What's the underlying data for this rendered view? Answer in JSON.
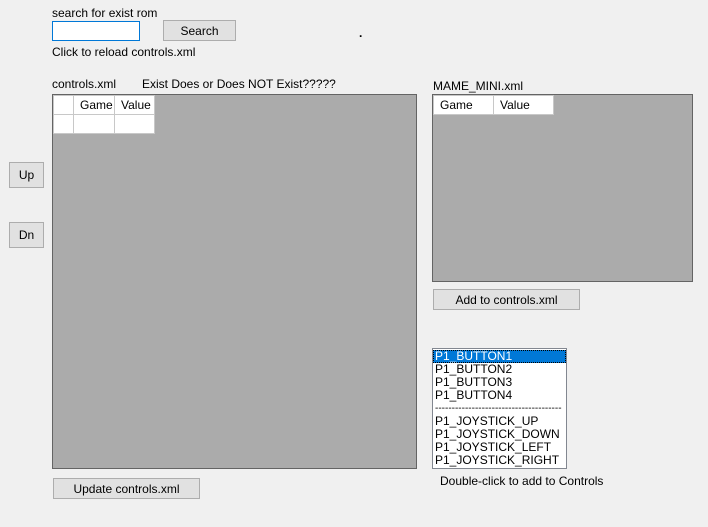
{
  "search": {
    "label": "search for exist rom",
    "value": "",
    "button_label": "Search"
  },
  "reload_label": "Click to reload controls.xml",
  "dot": ".",
  "controls": {
    "label": "controls.xml",
    "exist_label": "Exist Does or Does NOT Exist?????",
    "columns": [
      "Game",
      "Value"
    ],
    "update_button_label": "Update controls.xml"
  },
  "mame": {
    "label": "MAME_MINI.xml",
    "columns": [
      "Game",
      "Value"
    ],
    "add_button_label": "Add to controls.xml"
  },
  "nav": {
    "up_label": "Up",
    "dn_label": "Dn"
  },
  "listbox": {
    "items": [
      "P1_BUTTON1",
      "P1_BUTTON2",
      "P1_BUTTON3",
      "P1_BUTTON4",
      "--------------------------------------",
      "P1_JOYSTICK_UP",
      "P1_JOYSTICK_DOWN",
      "P1_JOYSTICK_LEFT",
      "P1_JOYSTICK_RIGHT"
    ],
    "selected_index": 0,
    "hint": "Double-click to add to Controls"
  },
  "colors": {
    "selection": "#0078d7",
    "grid_background": "#ababab",
    "form_background": "#f0f0f0"
  }
}
